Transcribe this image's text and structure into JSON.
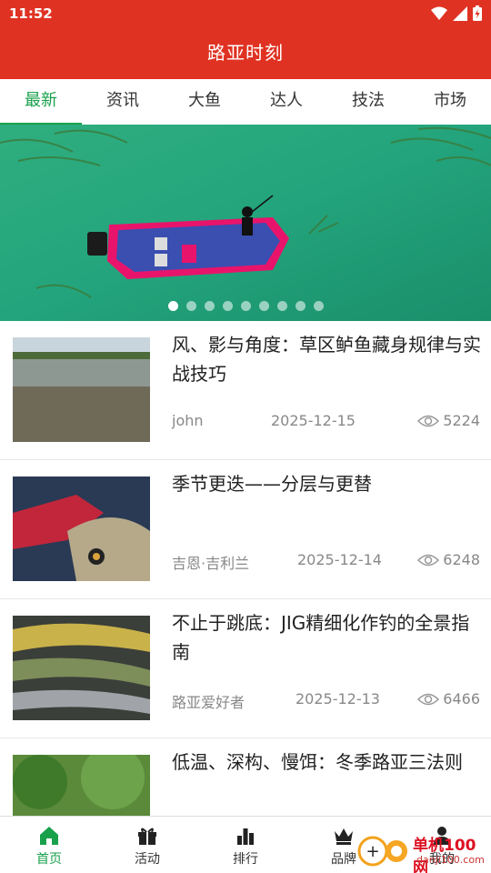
{
  "status": {
    "time": "11:52"
  },
  "header": {
    "title": "路亚时刻"
  },
  "tabs": [
    {
      "label": "最新",
      "active": true
    },
    {
      "label": "资讯",
      "active": false
    },
    {
      "label": "大鱼",
      "active": false
    },
    {
      "label": "达人",
      "active": false
    },
    {
      "label": "技法",
      "active": false
    },
    {
      "label": "市场",
      "active": false
    }
  ],
  "banner": {
    "slides": 9,
    "current": 1
  },
  "articles": [
    {
      "title": "风、影与角度：草区鲈鱼藏身规律与实战技巧",
      "author": "john",
      "date": "2025-12-15",
      "views": "5224"
    },
    {
      "title": "季节更迭——分层与更替",
      "author": "吉恩·吉利兰",
      "date": "2025-12-14",
      "views": "6248"
    },
    {
      "title": "不止于跳底：JIG精细化作钓的全景指南",
      "author": "路亚爱好者",
      "date": "2025-12-13",
      "views": "6466"
    },
    {
      "title": "低温、深构、慢饵：冬季路亚三法则",
      "author": "",
      "date": "",
      "views": ""
    }
  ],
  "bottom_nav": [
    {
      "label": "首页",
      "icon": "home-icon",
      "active": true
    },
    {
      "label": "活动",
      "icon": "gift-icon",
      "active": false
    },
    {
      "label": "排行",
      "icon": "bar-chart-icon",
      "active": false
    },
    {
      "label": "品牌",
      "icon": "crown-icon",
      "active": false
    },
    {
      "label": "我的",
      "icon": "user-icon",
      "active": false
    }
  ],
  "watermark": {
    "text": "单机100网",
    "url": "danji100.com"
  },
  "colors": {
    "brand_red": "#e03222",
    "accent_green": "#19a04b"
  }
}
